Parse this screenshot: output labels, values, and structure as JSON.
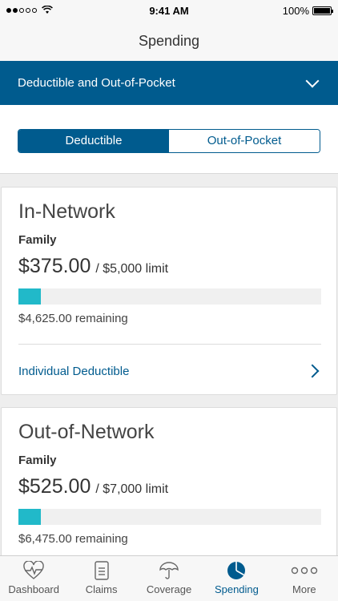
{
  "status_bar": {
    "time": "9:41 AM",
    "battery": "100%"
  },
  "nav": {
    "title": "Spending"
  },
  "dropdown": {
    "label": "Deductible and Out-of-Pocket"
  },
  "segments": {
    "deductible": "Deductible",
    "out_of_pocket": "Out-of-Pocket",
    "selected": "Deductible"
  },
  "cards": [
    {
      "title": "In-Network",
      "subtitle": "Family",
      "amount": "$375.00",
      "limit": "/ $5,000 limit",
      "progress_fraction": 0.075,
      "remaining": "$4,625.00 remaining",
      "link": "Individual Deductible"
    },
    {
      "title": "Out-of-Network",
      "subtitle": "Family",
      "amount": "$525.00",
      "limit": "/ $7,000 limit",
      "progress_fraction": 0.075,
      "remaining": "$6,475.00 remaining"
    }
  ],
  "tabbar": {
    "tabs": [
      {
        "label": "Dashboard",
        "icon": "heart-pulse-icon"
      },
      {
        "label": "Claims",
        "icon": "document-icon"
      },
      {
        "label": "Coverage",
        "icon": "umbrella-icon"
      },
      {
        "label": "Spending",
        "icon": "pie-chart-icon"
      },
      {
        "label": "More",
        "icon": "more-dots-icon"
      }
    ],
    "active": "Spending"
  },
  "colors": {
    "primary": "#005b8e",
    "progress": "#21b9c9"
  }
}
